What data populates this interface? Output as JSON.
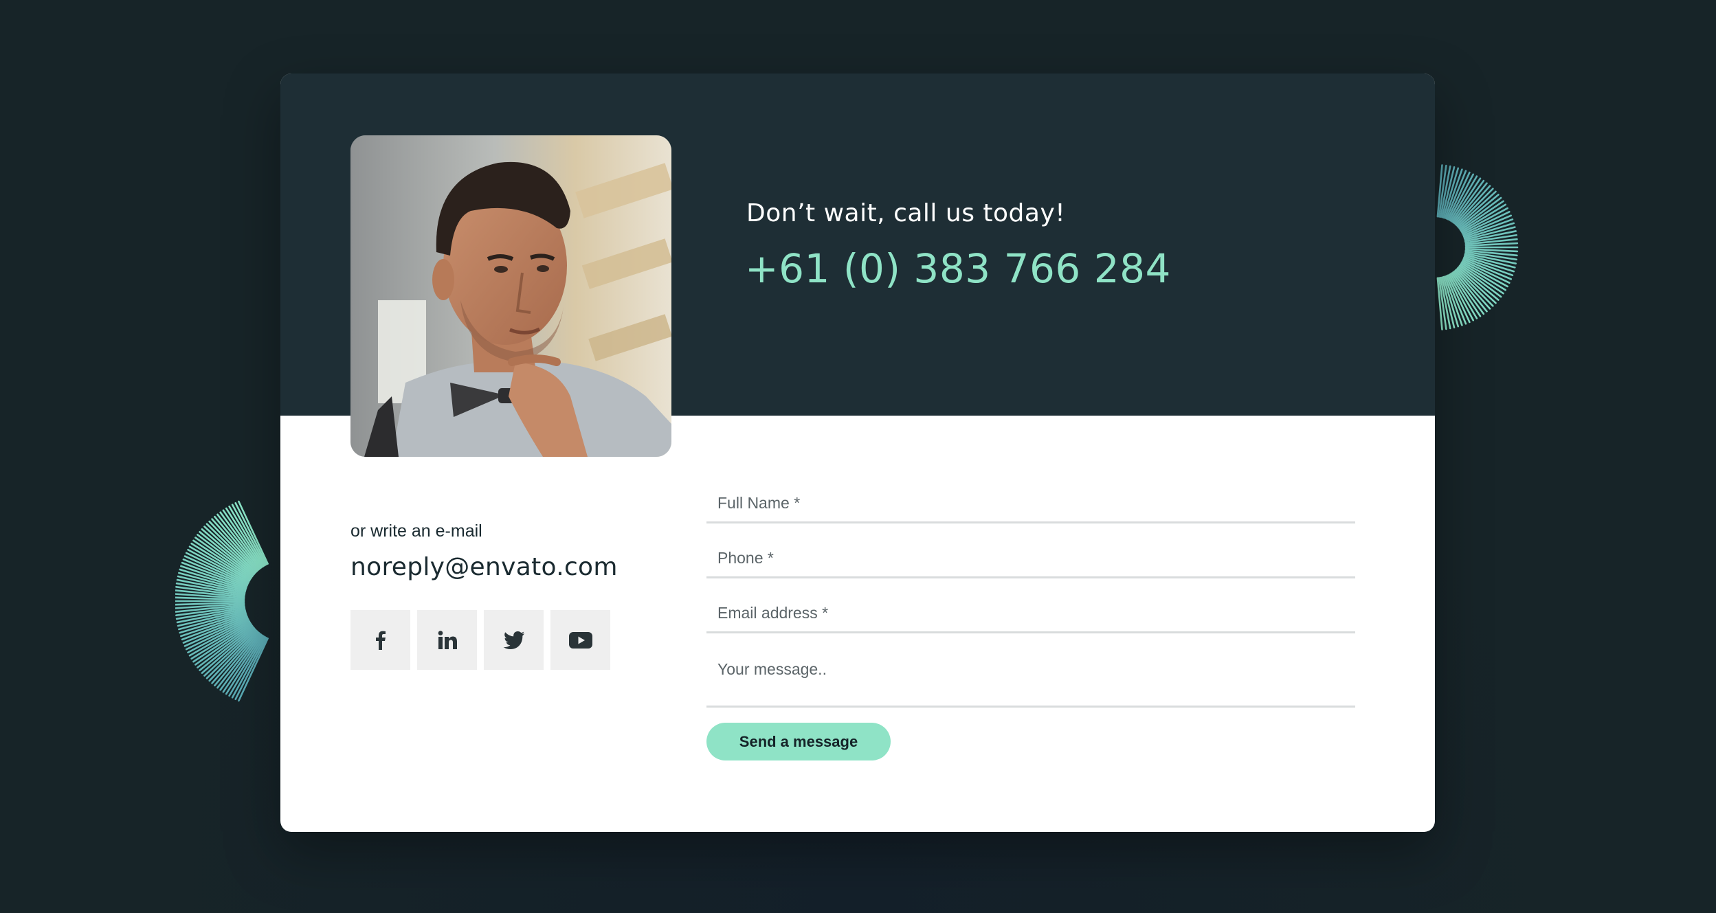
{
  "header": {
    "headline": "Don’t wait, call us today!",
    "phone_number": "+61 (0) 383 766 284"
  },
  "contact": {
    "intro": "or write an e-mail",
    "email": "noreply@envato.com"
  },
  "socials": [
    {
      "name": "facebook",
      "icon": "facebook-icon"
    },
    {
      "name": "linkedin",
      "icon": "linkedin-icon"
    },
    {
      "name": "twitter",
      "icon": "twitter-icon"
    },
    {
      "name": "youtube",
      "icon": "youtube-icon"
    }
  ],
  "form": {
    "full_name_placeholder": "Full Name *",
    "phone_placeholder": "Phone *",
    "email_placeholder": "Email address *",
    "message_placeholder": "Your message..",
    "submit_label": "Send a message"
  },
  "colors": {
    "background": "#172428",
    "card_dark": "#1e2e35",
    "accent": "#8fe3c6",
    "text_dark": "#1a2a30",
    "social_bg": "#efefef"
  }
}
